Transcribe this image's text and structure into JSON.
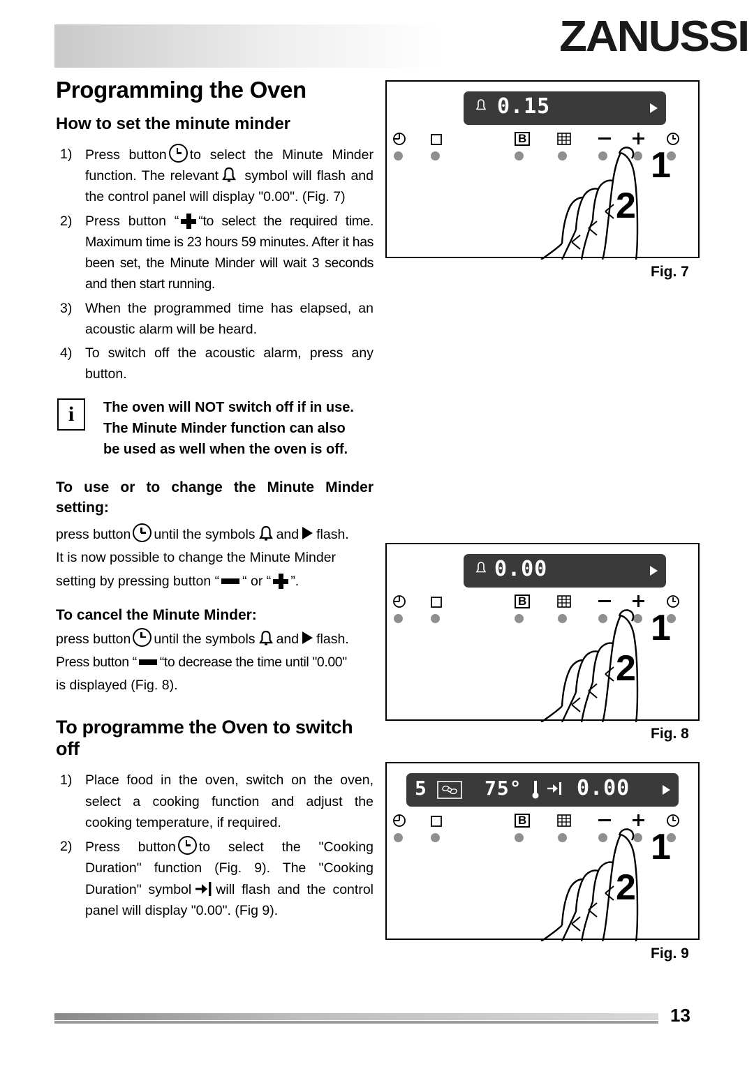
{
  "brand": "ZANUSSI",
  "page_number": "13",
  "title": "Programming the Oven",
  "section1": {
    "heading": "How to set the minute minder",
    "steps": [
      {
        "num": "1)",
        "parts": [
          "Press button",
          "to select the Minute Minder function. The relevant",
          "symbol will flash and the control panel will display \"0.00\". (Fig. 7)"
        ]
      },
      {
        "num": "2)",
        "parts": [
          "Press button “",
          "“to select the required time. Maximum time is 23 hours 59 minutes. After it has been set, the Minute Minder will wait 3 seconds and then start running."
        ]
      },
      {
        "num": "3)",
        "text": "When the programmed time has elapsed, an acoustic alarm will be heard."
      },
      {
        "num": "4)",
        "text": "To switch off the acoustic alarm, press any button."
      }
    ]
  },
  "note": {
    "icon": "i",
    "line1": "The oven will NOT switch off if in use.",
    "line2": "The Minute Minder function can also",
    "line3": "be used as well when the oven is off."
  },
  "section2": {
    "heading_l1": "To use or to change the Minute Minder",
    "heading_l2": "setting:",
    "p1a": "press button",
    "p1b": "until the symbols",
    "p1c": "and",
    "p1d": "flash.",
    "p2": "It is now possible to change the Minute Minder",
    "p3a": "setting by pressing button “",
    "p3b": "“ or “",
    "p3c": "”."
  },
  "section3": {
    "heading": "To cancel the Minute Minder:",
    "p1a": "press button",
    "p1b": "until the symbols",
    "p1c": "and",
    "p1d": "flash.",
    "p2a": "Press button “",
    "p2b": "“to decrease the time until \"0.00\"",
    "p3": "is displayed (Fig. 8)."
  },
  "section4": {
    "heading": "To programme the Oven to switch off",
    "steps": [
      {
        "num": "1)",
        "text": "Place food in the oven, switch on the oven, select a cooking function and adjust the cooking temperature, if required."
      },
      {
        "num": "2)",
        "parts": [
          "Press button",
          "to select the \"Cooking Duration\" function (Fig. 9). The \"Cooking Duration\" symbol",
          "will flash and the control panel will display \"0.00\". (Fig 9)."
        ]
      }
    ]
  },
  "figures": [
    {
      "caption": "Fig. 7",
      "display_value": "0.15",
      "display_bell": true,
      "display_arrow": true,
      "hand_labels": [
        "1",
        "2"
      ],
      "buttons": [
        "power-icon",
        "square-icon",
        "b-icon",
        "grid-icon",
        "minus-icon",
        "plus-icon",
        "clock-icon"
      ]
    },
    {
      "caption": "Fig. 8",
      "display_value": "0.00",
      "display_bell": true,
      "display_arrow": true,
      "hand_labels": [
        "1",
        "2"
      ],
      "buttons": [
        "power-icon",
        "square-icon",
        "b-icon",
        "grid-icon",
        "minus-icon",
        "plus-icon",
        "clock-icon"
      ]
    },
    {
      "caption": "Fig. 9",
      "display_left": "5",
      "display_fan": "fan-icon",
      "display_temp": "75°",
      "display_duration": "duration-icon",
      "display_value": "0.00",
      "display_arrow": true,
      "hand_labels": [
        "1",
        "2"
      ],
      "buttons": [
        "power-icon",
        "square-icon",
        "b-icon",
        "grid-icon",
        "minus-icon",
        "plus-icon",
        "clock-icon"
      ]
    }
  ]
}
